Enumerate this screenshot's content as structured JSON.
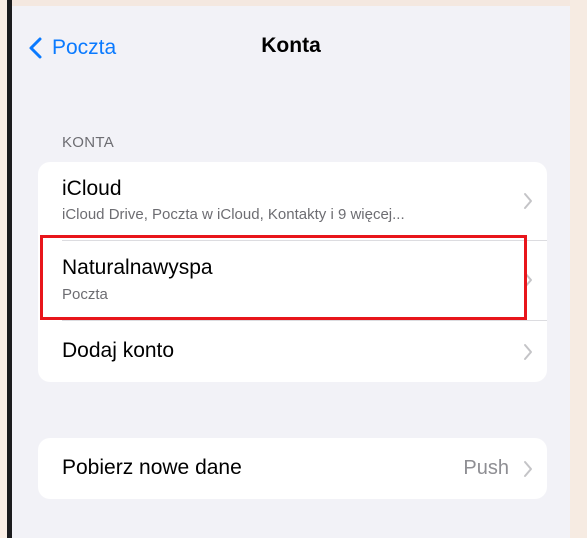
{
  "navbar": {
    "back_label": "Poczta",
    "title": "Konta"
  },
  "section_header": "KONTA",
  "accounts": [
    {
      "title": "iCloud",
      "subtitle": "iCloud Drive, Poczta w iCloud, Kontakty i 9 więcej..."
    },
    {
      "title": "Naturalnawyspa",
      "subtitle": "Poczta"
    }
  ],
  "add_account_label": "Dodaj konto",
  "fetch": {
    "label": "Pobierz nowe dane",
    "value": "Push"
  },
  "colors": {
    "accent": "#0a7aff",
    "highlight": "#e8151b",
    "background": "#f2f2f7",
    "secondary_text": "#6d6d72",
    "chevron": "#c4c4c7"
  },
  "icons": [
    "chevron-left-icon",
    "chevron-right-icon"
  ]
}
